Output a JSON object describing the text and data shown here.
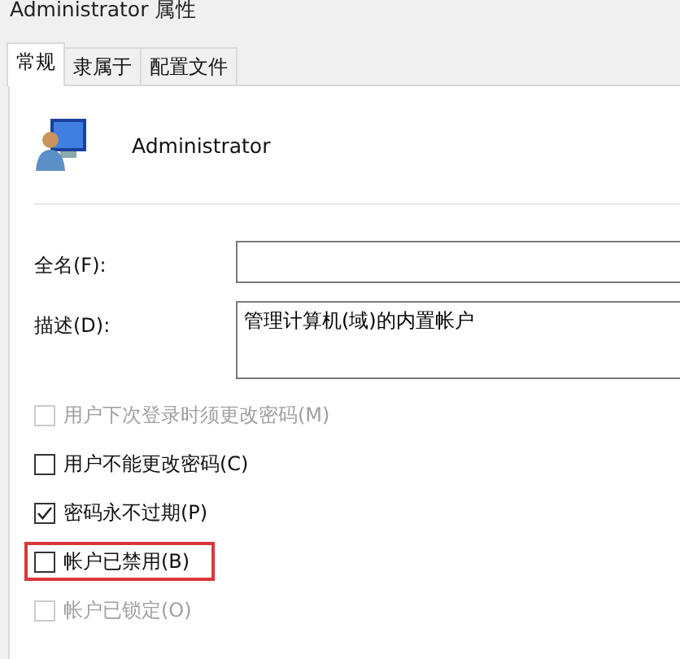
{
  "window": {
    "title": "Administrator 属性"
  },
  "tabs": [
    {
      "label": "常规",
      "selected": true
    },
    {
      "label": "隶属于",
      "selected": false
    },
    {
      "label": "配置文件",
      "selected": false
    }
  ],
  "user": {
    "name": "Administrator"
  },
  "fields": [
    {
      "label": "全名(F):",
      "multiline": false
    },
    {
      "label": "描述(D):",
      "value": "管理计算机(域)的内置帐户",
      "multiline": true
    }
  ],
  "options": [
    {
      "label": "用户下次登录时须更改密码(M)",
      "checked": false,
      "disabled": true,
      "highlighted": false
    },
    {
      "label": "用户不能更改密码(C)",
      "checked": false,
      "disabled": false,
      "highlighted": false
    },
    {
      "label": "密码永不过期(P)",
      "checked": true,
      "disabled": false,
      "highlighted": false
    },
    {
      "label": "帐户已禁用(B)",
      "checked": false,
      "disabled": false,
      "highlighted": true
    },
    {
      "label": "帐户已锁定(O)",
      "checked": false,
      "disabled": true,
      "highlighted": false
    }
  ]
}
